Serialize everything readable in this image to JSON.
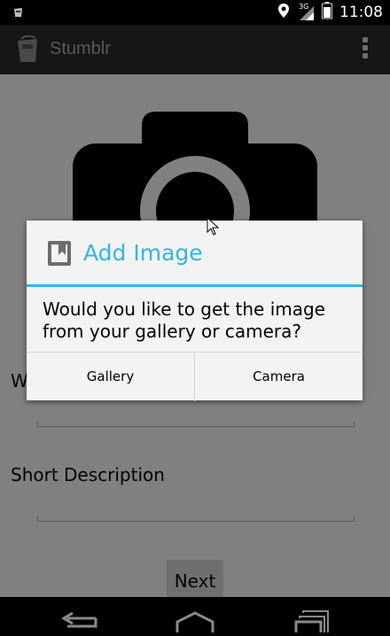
{
  "status_bar": {
    "time": "11:08",
    "network_label": "3G",
    "icons": [
      "notification-icon",
      "location-icon",
      "signal-icon",
      "battery-icon"
    ]
  },
  "action_bar": {
    "title": "Stumblr",
    "icons": [
      "app-icon",
      "overflow-menu-icon"
    ]
  },
  "form": {
    "website_label_partial": "W",
    "short_description_label": "Short Description",
    "next_label": "Next"
  },
  "dialog": {
    "title": "Add Image",
    "message": "Would you like to get the image from your gallery or camera?",
    "buttons": [
      {
        "label": "Gallery"
      },
      {
        "label": "Camera"
      }
    ]
  },
  "colors": {
    "accent": "#33b5e5",
    "overlay_background": "#808080",
    "dialog_background": "#f3f3f3"
  },
  "nav_bar": {
    "icons": [
      "back-icon",
      "home-icon",
      "recents-icon"
    ]
  }
}
